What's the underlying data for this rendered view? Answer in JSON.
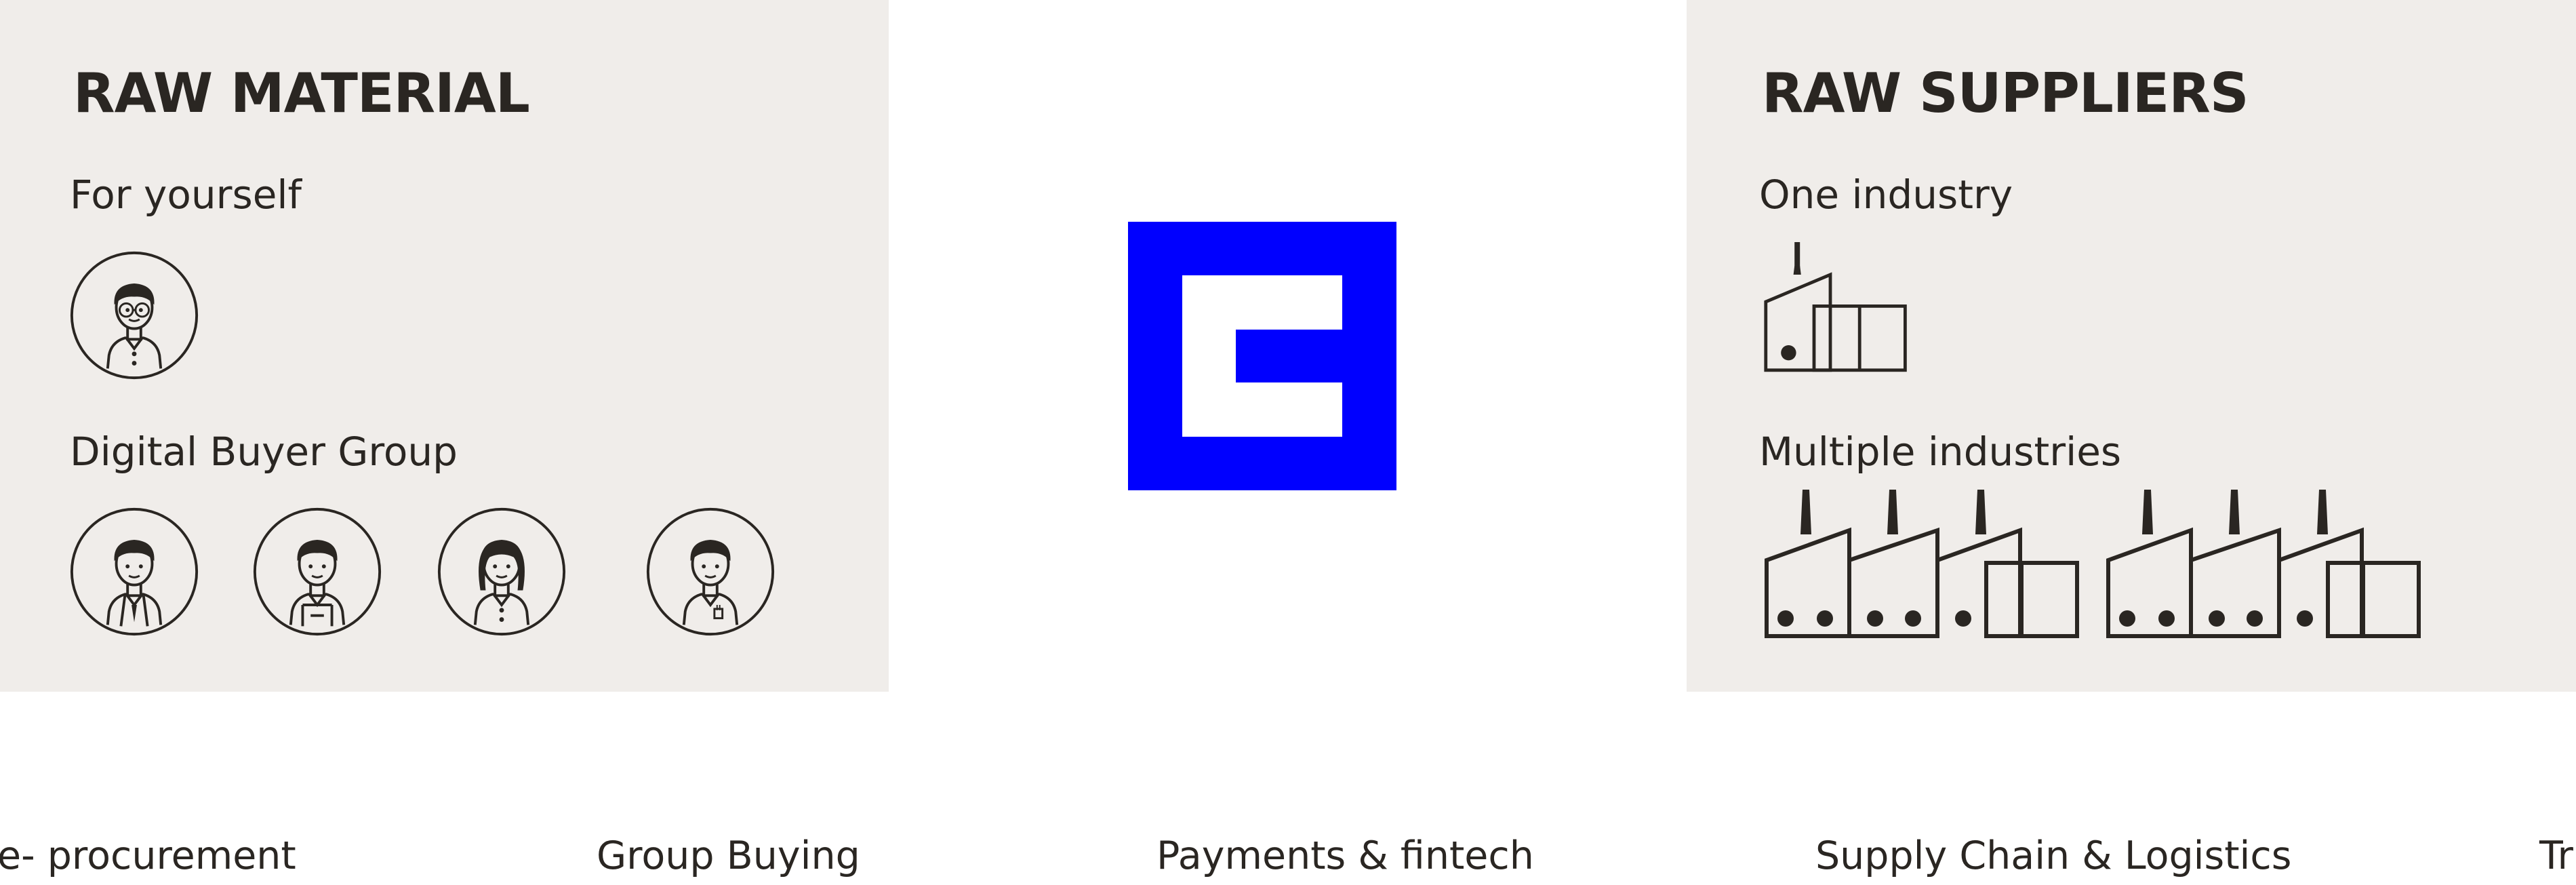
{
  "left_panel": {
    "title": "RAW MATERIAL",
    "section_1_label": "For yourself",
    "section_2_label": "Digital Buyer Group"
  },
  "right_panel": {
    "title": "RAW SUPPLIERS",
    "section_1_label": "One industry",
    "section_2_label": "Multiple industries"
  },
  "bottom_labels": {
    "item_1": "e- procurement",
    "item_2": "Group Buying",
    "item_3": "Payments & fintech",
    "item_4": "Supply Chain & Logistics",
    "item_5": "Tr"
  },
  "colors": {
    "panel_background": "#f0edea",
    "logo_blue": "#0000ff",
    "ink": "#2a2622"
  }
}
